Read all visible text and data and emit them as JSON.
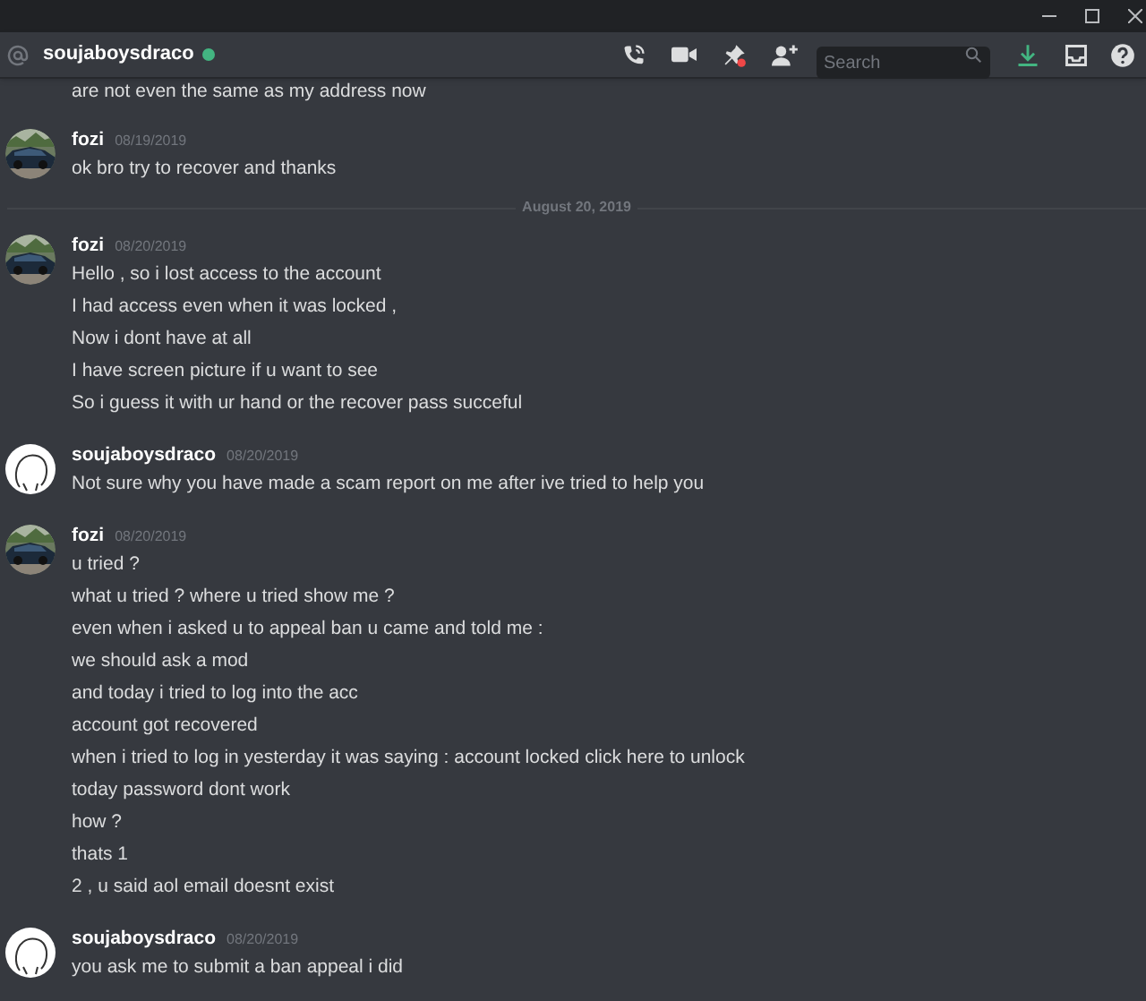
{
  "channel": {
    "name": "soujaboysdraco",
    "online": true
  },
  "search": {
    "placeholder": "Search"
  },
  "messages": [
    {
      "kind": "continuation",
      "lines": [
        "are not even the same as my address now"
      ]
    },
    {
      "kind": "message",
      "author": "fozi",
      "time": "08/19/2019",
      "lines": [
        "ok bro try to recover and thanks"
      ]
    },
    {
      "kind": "divider",
      "label": "August 20, 2019"
    },
    {
      "kind": "message",
      "author": "fozi",
      "time": "08/20/2019",
      "lines": [
        "Hello , so i lost access to the account",
        "I had access even when it was locked ,",
        "Now i dont have at all",
        "I have screen picture if u want to see",
        "So i guess it with ur hand or the recover pass succeful"
      ]
    },
    {
      "kind": "message",
      "author": "soujaboysdraco",
      "avatar": {
        "kind": "sketch"
      },
      "time": "08/20/2019",
      "lines": [
        "Not sure why you have made a scam report on me after ive tried to help you"
      ]
    },
    {
      "kind": "message",
      "author": "fozi",
      "time": "08/20/2019",
      "lines": [
        "u tried ?",
        "what u tried ? where u tried show me ?",
        "even when i asked u to appeal ban u came and told me :",
        "we should ask a mod",
        "and today i tried to log into the acc",
        "account got recovered",
        "when i tried to log in yesterday it was saying : account locked click here to unlock",
        "today password dont work",
        "how ?",
        "thats 1",
        "2 , u said aol email doesnt exist"
      ]
    },
    {
      "kind": "message",
      "author": "soujaboysdraco",
      "avatar": {
        "kind": "sketch"
      },
      "time": "08/20/2019",
      "lines": [
        "you ask me to submit a ban appeal i did"
      ]
    }
  ]
}
